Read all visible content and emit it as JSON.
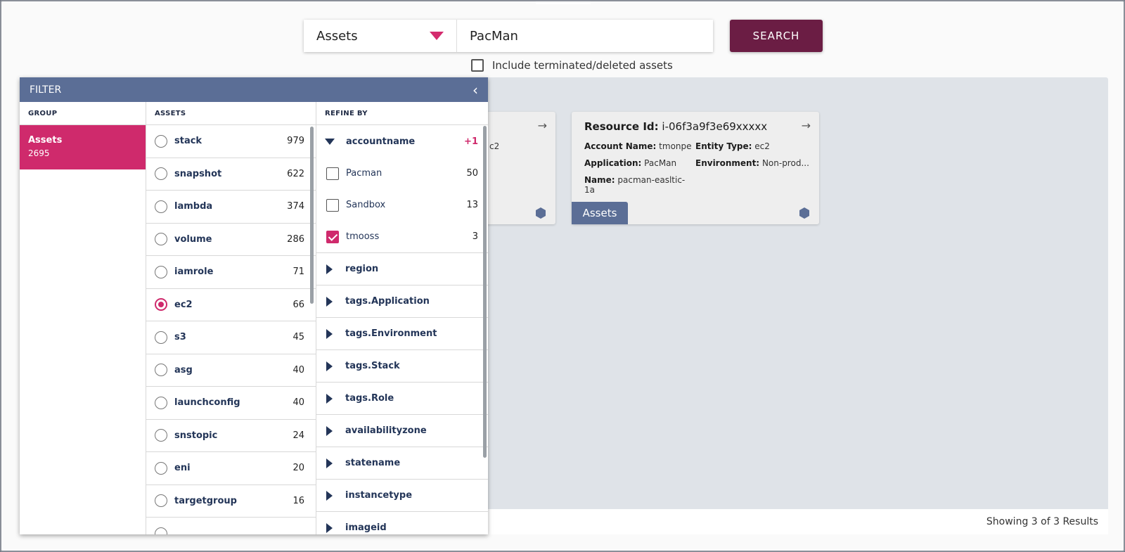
{
  "search": {
    "type_value": "Assets",
    "query_value": "PacMan",
    "button_label": "SEARCH",
    "include_label": "Include terminated/deleted assets"
  },
  "filter": {
    "title": "FILTER",
    "columns": {
      "group": "GROUP",
      "assets": "ASSETS",
      "refine": "REFINE BY"
    },
    "group": {
      "name": "Assets",
      "count": "2695"
    },
    "assets": [
      {
        "name": "stack",
        "count": "979"
      },
      {
        "name": "snapshot",
        "count": "622"
      },
      {
        "name": "lambda",
        "count": "374"
      },
      {
        "name": "volume",
        "count": "286"
      },
      {
        "name": "iamrole",
        "count": "71"
      },
      {
        "name": "ec2",
        "count": "66"
      },
      {
        "name": "s3",
        "count": "45"
      },
      {
        "name": "asg",
        "count": "40"
      },
      {
        "name": "launchconfig",
        "count": "40"
      },
      {
        "name": "snstopic",
        "count": "24"
      },
      {
        "name": "eni",
        "count": "20"
      },
      {
        "name": "targetgroup",
        "count": "16"
      },
      {
        "name": "",
        "count": ""
      }
    ],
    "refine": {
      "expanded": {
        "name": "accountname",
        "extra": "+1",
        "options": [
          {
            "name": "Pacman",
            "count": "50"
          },
          {
            "name": "Sandbox",
            "count": "13"
          },
          {
            "name": "tmooss",
            "count": "3"
          }
        ]
      },
      "collapsed": [
        "region",
        "tags.Application",
        "tags.Environment",
        "tags.Stack",
        "tags.Role",
        "availabilityzone",
        "statename",
        "instancetype",
        "imageid"
      ]
    }
  },
  "cards": {
    "card1": {
      "partial": "c2"
    },
    "card2": {
      "id_label": "Resource Id:",
      "id_value": "i-06f3a9f3e69xxxxx",
      "account_label": "Account Name:",
      "account_value": "tmonpe",
      "entity_label": "Entity Type:",
      "entity_value": "ec2",
      "application_label": "Application:",
      "application_value": "PacMan",
      "environment_label": "Environment:",
      "environment_value": "Non-prod...",
      "name_label": "Name:",
      "name_value": "pacman-easltic-1a",
      "tag": "Assets"
    }
  },
  "footer": {
    "results_text": "Showing 3 of 3 Results"
  },
  "colors": {
    "accent": "#cf2a6c",
    "header": "#5b6e96",
    "button": "#6b1d44"
  }
}
